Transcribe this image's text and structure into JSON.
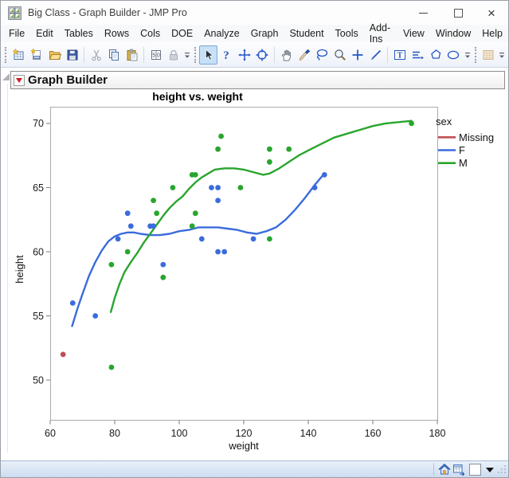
{
  "window": {
    "title": "Big Class - Graph Builder - JMP Pro",
    "controls": [
      "minimize",
      "maximize",
      "close"
    ]
  },
  "menu": {
    "items": [
      "File",
      "Edit",
      "Tables",
      "Rows",
      "Cols",
      "DOE",
      "Analyze",
      "Graph",
      "Student",
      "Tools",
      "Add-Ins",
      "View",
      "Window",
      "Help"
    ]
  },
  "toolbar": {
    "groups": [
      [
        "new-data-table-icon",
        "new-window-icon",
        "open-icon",
        "save-icon",
        "|",
        "cut-icon",
        "copy-icon",
        "paste-icon",
        "|",
        "window-settings-icon",
        "lock-icon",
        "overflow-icon"
      ],
      [
        "arrow-tool-icon",
        "help-tool-icon",
        "move-tool-icon",
        "brush-tool-icon",
        "|",
        "hand-tool-icon",
        "paint-tool-icon",
        "lasso-tool-icon",
        "zoom-tool-icon",
        "crosshair-tool-icon",
        "line-tool-icon",
        "|",
        "text-tool-icon",
        "lines-tool-icon",
        "polygon-tool-icon",
        "oval-tool-icon",
        "overflow-icon"
      ],
      [
        "table-disabled-icon",
        "overflow-icon"
      ]
    ],
    "selected_tool": "arrow-tool-icon"
  },
  "report": {
    "header": "Graph Builder"
  },
  "chart_data": {
    "type": "scatter",
    "title": "height vs. weight",
    "xlabel": "weight",
    "ylabel": "height",
    "xlim": [
      60,
      180
    ],
    "ylim": [
      46.9,
      71.3
    ],
    "xticks": [
      60,
      80,
      100,
      120,
      140,
      160,
      180
    ],
    "yticks": [
      50,
      55,
      60,
      65,
      70
    ],
    "grid": false,
    "legend_title": "sex",
    "legend_position": "right",
    "series": [
      {
        "name": "Missing",
        "color": "#C04F58",
        "points": [
          [
            64,
            52
          ]
        ],
        "smoother": []
      },
      {
        "name": "F",
        "color": "#3A6CDB",
        "points": [
          [
            67,
            56
          ],
          [
            74,
            55
          ],
          [
            81,
            61
          ],
          [
            84,
            63
          ],
          [
            85,
            62
          ],
          [
            91,
            62
          ],
          [
            92,
            62
          ],
          [
            95,
            59
          ],
          [
            107,
            61
          ],
          [
            110,
            65
          ],
          [
            112,
            65
          ],
          [
            112,
            64
          ],
          [
            112,
            60
          ],
          [
            114,
            60
          ],
          [
            123,
            61
          ],
          [
            142,
            65
          ],
          [
            145,
            66
          ]
        ],
        "smoother": [
          [
            66.8,
            54.2
          ],
          [
            68.5,
            55.6
          ],
          [
            70,
            56.7
          ],
          [
            72,
            58.1
          ],
          [
            74,
            59.2
          ],
          [
            76,
            60.1
          ],
          [
            78,
            60.8
          ],
          [
            80,
            61.2
          ],
          [
            82,
            61.4
          ],
          [
            84,
            61.5
          ],
          [
            86,
            61.5
          ],
          [
            88,
            61.4
          ],
          [
            91,
            61.3
          ],
          [
            94,
            61.3
          ],
          [
            97,
            61.4
          ],
          [
            100,
            61.6
          ],
          [
            103,
            61.7
          ],
          [
            106,
            61.9
          ],
          [
            109,
            61.9
          ],
          [
            112,
            61.9
          ],
          [
            115,
            61.8
          ],
          [
            118,
            61.7
          ],
          [
            121,
            61.5
          ],
          [
            124,
            61.4
          ],
          [
            127,
            61.6
          ],
          [
            130,
            61.9
          ],
          [
            133,
            62.5
          ],
          [
            136,
            63.3
          ],
          [
            139,
            64.2
          ],
          [
            142,
            65.2
          ],
          [
            144,
            65.8
          ],
          [
            145,
            66.1
          ]
        ]
      },
      {
        "name": "M",
        "color": "#29A52E",
        "points": [
          [
            79,
            51
          ],
          [
            79,
            59
          ],
          [
            84,
            60
          ],
          [
            92,
            64
          ],
          [
            93,
            63
          ],
          [
            95,
            58
          ],
          [
            98,
            65
          ],
          [
            104,
            66
          ],
          [
            105,
            66
          ],
          [
            105,
            63
          ],
          [
            104,
            62
          ],
          [
            112,
            68
          ],
          [
            113,
            69
          ],
          [
            119,
            65
          ],
          [
            128,
            61
          ],
          [
            128,
            67
          ],
          [
            128,
            68
          ],
          [
            134,
            68
          ],
          [
            172,
            70
          ]
        ],
        "smoother": [
          [
            78.8,
            55.3
          ],
          [
            80,
            56.4
          ],
          [
            81.5,
            57.5
          ],
          [
            83,
            58.4
          ],
          [
            85,
            59.2
          ],
          [
            87,
            59.9
          ],
          [
            89,
            60.7
          ],
          [
            91,
            61.4
          ],
          [
            93,
            62.1
          ],
          [
            95,
            62.8
          ],
          [
            97,
            63.4
          ],
          [
            99,
            63.9
          ],
          [
            101,
            64.3
          ],
          [
            103,
            64.9
          ],
          [
            105,
            65.4
          ],
          [
            107,
            65.8
          ],
          [
            109,
            66.1
          ],
          [
            111,
            66.4
          ],
          [
            114,
            66.5
          ],
          [
            117,
            66.5
          ],
          [
            120,
            66.4
          ],
          [
            123,
            66.2
          ],
          [
            126,
            66.0
          ],
          [
            128,
            66.1
          ],
          [
            131,
            66.5
          ],
          [
            134,
            67.0
          ],
          [
            137,
            67.5
          ],
          [
            140,
            67.9
          ],
          [
            144,
            68.4
          ],
          [
            148,
            68.9
          ],
          [
            152,
            69.2
          ],
          [
            156,
            69.5
          ],
          [
            160,
            69.8
          ],
          [
            164,
            70.0
          ],
          [
            168,
            70.1
          ],
          [
            172,
            70.2
          ]
        ]
      }
    ]
  },
  "statusbar": {
    "icons": [
      "home-icon",
      "table-window-icon"
    ]
  }
}
